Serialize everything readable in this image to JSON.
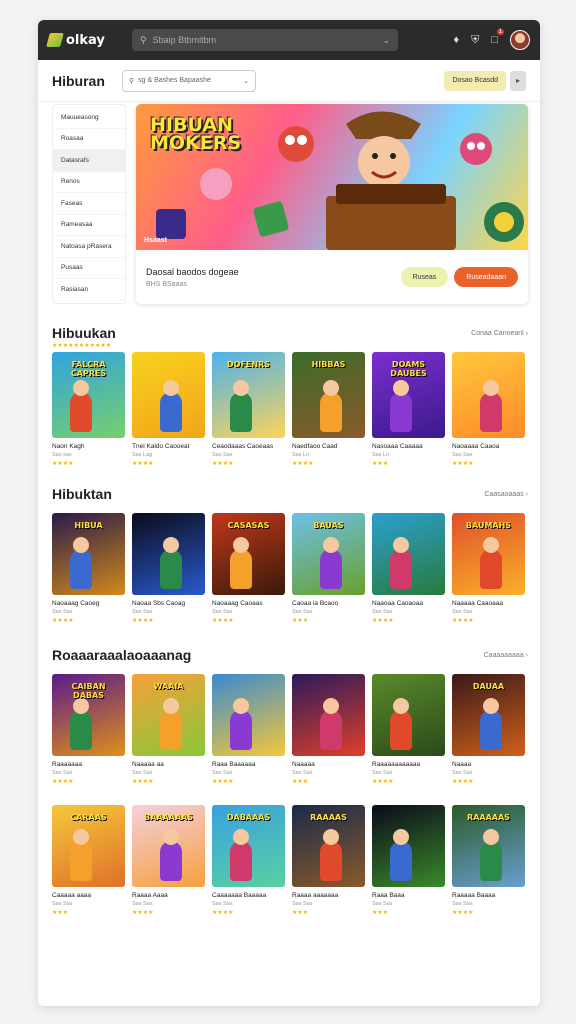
{
  "topbar": {
    "logo": "olkay",
    "search_placeholder": "Sbaip Btbmitbm",
    "badge": "1"
  },
  "subbar": {
    "title": "Hiburan",
    "filter_placeholder": "sg & Bashes Bapaashe",
    "action_label": "Dosao Bcasdd"
  },
  "side_menu": [
    "Mauueasong",
    "Roasaa",
    "Datasrafs",
    "Renos",
    "Faseas",
    "Rameasaa",
    "Natoasa pRasera",
    "Pusaas",
    "Rasiasan"
  ],
  "hero": {
    "title_line1": "HIBUAN",
    "title_line2": "MOKERS",
    "caption": "Hsaast",
    "text": "Daosal baodos dogeae",
    "subtext": "BHS BSaaas",
    "btn_secondary": "Ruseas",
    "btn_primary": "Ruseadaaan"
  },
  "sections": [
    {
      "title": "Hibuukan",
      "link": "Conaa Canoeanl",
      "show_stars": true,
      "cards": [
        {
          "label": "FALCRA CAPRES",
          "name": "Naon Kagh",
          "sub": "Sas sas",
          "stars": "★★★★",
          "c1": "#2fa3e0",
          "c2": "#78d06a"
        },
        {
          "label": "",
          "name": "Tnel Kaldo Caooeat",
          "sub": "Sas Lag",
          "stars": "★★★★",
          "c1": "#f7d21c",
          "c2": "#f2a51b"
        },
        {
          "label": "DOFENRS",
          "name": "Ceaodaaas Caoeaas",
          "sub": "Sas Sas",
          "stars": "★★★★",
          "c1": "#4db2ea",
          "c2": "#fbd45b"
        },
        {
          "label": "HIBBAS",
          "name": "Naedfaoo Caad",
          "sub": "Sas Ln",
          "stars": "★★★★",
          "c1": "#3a6b2a",
          "c2": "#8c5a2b"
        },
        {
          "label": "DOAMS DAUBES",
          "name": "Nasoaaa Caaaaa",
          "sub": "Sas Ln",
          "stars": "★★★",
          "c1": "#7b2fd0",
          "c2": "#3a1a8a"
        },
        {
          "label": "",
          "name": "Naoaaaa Caaoa",
          "sub": "Sas Sas",
          "stars": "★★★★",
          "c1": "#ffc83a",
          "c2": "#ff8a2a"
        }
      ]
    },
    {
      "title": "Hibuktan",
      "link": "Caasaoaaas",
      "show_stars": false,
      "cards": [
        {
          "label": "HIBUA",
          "name": "Naoaaag Caoeg",
          "sub": "Sas Sas",
          "stars": "★★★★",
          "c1": "#2a1a4a",
          "c2": "#d18a1a"
        },
        {
          "label": "",
          "name": "Naoaa Sbs Caoag",
          "sub": "Sas Sas",
          "stars": "★★★★",
          "c1": "#0b0b1a",
          "c2": "#2a5ad0"
        },
        {
          "label": "CASASAS",
          "name": "Naoaaag Caoaas",
          "sub": "Sas Sas",
          "stars": "★★★★",
          "c1": "#c0381a",
          "c2": "#3a1a0a"
        },
        {
          "label": "BAUAS",
          "name": "Caoaa ia Bcaoo",
          "sub": "Sas Sas",
          "stars": "★★★",
          "c1": "#6cc0ea",
          "c2": "#6aa02a"
        },
        {
          "label": "",
          "name": "Naaoaa Caoaoaa",
          "sub": "Sas Sas",
          "stars": "★★★★",
          "c1": "#2aa0d0",
          "c2": "#2a7a3a"
        },
        {
          "label": "BAUMAHS",
          "name": "Naaaaa Caaoaaa",
          "sub": "Sas Sas",
          "stars": "★★★★",
          "c1": "#e0502a",
          "c2": "#fbb02a"
        }
      ]
    },
    {
      "title": "Roaaaraaalaoaaanag",
      "link": "Caaaaaaaaa",
      "show_stars": false,
      "cards": [
        {
          "label": "CAIBAN DABAS",
          "name": "Raaaaaaa",
          "sub": "Sas Sas",
          "stars": "★★★★",
          "c1": "#5a1a8a",
          "c2": "#e0901a"
        },
        {
          "label": "WAAIA",
          "name": "Naaaaa aa",
          "sub": "Sas Sas",
          "stars": "★★★★",
          "c1": "#f5a03a",
          "c2": "#8ac83a"
        },
        {
          "label": "",
          "name": "Raaa Baaaaaa",
          "sub": "Sas Sas",
          "stars": "★★★★",
          "c1": "#3a8ad0",
          "c2": "#f5c83a"
        },
        {
          "label": "",
          "name": "Naaaaa",
          "sub": "Sas Sas",
          "stars": "★★★",
          "c1": "#2a1a5a",
          "c2": "#e0402a"
        },
        {
          "label": "",
          "name": "Raaaaaaaaaaaa",
          "sub": "Sas Sas",
          "stars": "★★★★",
          "c1": "#5a8a2a",
          "c2": "#2a4a1a"
        },
        {
          "label": "DAUAA",
          "name": "Naaaa",
          "sub": "Sas Sas",
          "stars": "★★★★",
          "c1": "#3a1a1a",
          "c2": "#d0601a"
        }
      ]
    },
    {
      "title": "",
      "link": "",
      "show_stars": false,
      "cards": [
        {
          "label": "CARAAS",
          "name": "Caaaaa aaaa",
          "sub": "Sas Sas",
          "stars": "★★★",
          "c1": "#f5c83a",
          "c2": "#e0702a"
        },
        {
          "label": "BAAAAAAS",
          "name": "Raaaa Aaaa",
          "sub": "Sas Sas",
          "stars": "★★★★",
          "c1": "#f5d0e0",
          "c2": "#f5a03a"
        },
        {
          "label": "DABAAAS",
          "name": "Caaaaaaa Baaaaa",
          "sub": "Sas Sas",
          "stars": "★★★★",
          "c1": "#3aa0e0",
          "c2": "#5ad0a0"
        },
        {
          "label": "RAAAAS",
          "name": "Raaaa aaaaaaa",
          "sub": "Sas Sas",
          "stars": "★★★",
          "c1": "#1a2a4a",
          "c2": "#8a5a2a"
        },
        {
          "label": "",
          "name": "Raaa Baaa",
          "sub": "Sas Sas",
          "stars": "★★★",
          "c1": "#0a0a1a",
          "c2": "#3a8a2a"
        },
        {
          "label": "RAAAAAS",
          "name": "Raaaaa Baaaa",
          "sub": "Sas Sas",
          "stars": "★★★★",
          "c1": "#2a5a2a",
          "c2": "#6aa0d0"
        }
      ]
    }
  ]
}
